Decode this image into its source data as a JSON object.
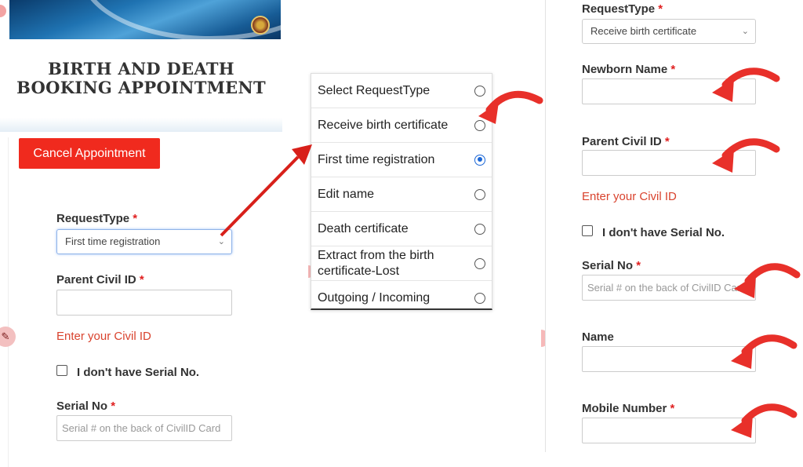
{
  "left": {
    "title_line1": "BIRTH AND DEATH",
    "title_line2": "BOOKING APPOINTMENT",
    "cancel_button": "Cancel Appointment",
    "request_type_label": "RequestType",
    "request_type_value": "First time registration",
    "parent_civil_id_label": "Parent Civil ID",
    "civil_id_help": "Enter your Civil ID",
    "no_serial_label": "I don't have Serial No.",
    "serial_label": "Serial No",
    "serial_placeholder": "Serial # on the back of CivilID Card",
    "required_mark": "*"
  },
  "dropdown": {
    "options": [
      {
        "label": "Select RequestType",
        "selected": false
      },
      {
        "label": "Receive birth certificate",
        "selected": false
      },
      {
        "label": "First time registration",
        "selected": true
      },
      {
        "label": "Edit name",
        "selected": false
      },
      {
        "label": "Death certificate",
        "selected": false
      },
      {
        "label": "Extract from the birth certificate-Lost",
        "selected": false
      },
      {
        "label": "Outgoing / Incoming",
        "selected": false
      }
    ]
  },
  "right": {
    "request_type_label": "RequestType",
    "request_type_value": "Receive birth certificate",
    "newborn_name_label": "Newborn Name",
    "parent_civil_id_label": "Parent Civil ID",
    "civil_id_help": "Enter your Civil ID",
    "no_serial_label": "I don't have Serial No.",
    "serial_label": "Serial No",
    "serial_placeholder": "Serial # on the back of CivilID Card",
    "name_label": "Name",
    "mobile_label": "Mobile Number",
    "required_mark": "*"
  },
  "colors": {
    "accent_red": "#f02a1e",
    "arrow_red": "#e8302a",
    "radio_blue": "#1a66d6",
    "help_red": "#d9432e"
  },
  "icons": [
    "chevron-down-icon",
    "curved-arrow-icon",
    "pointer-arrow-icon",
    "emblem-icon",
    "edit-icon"
  ]
}
